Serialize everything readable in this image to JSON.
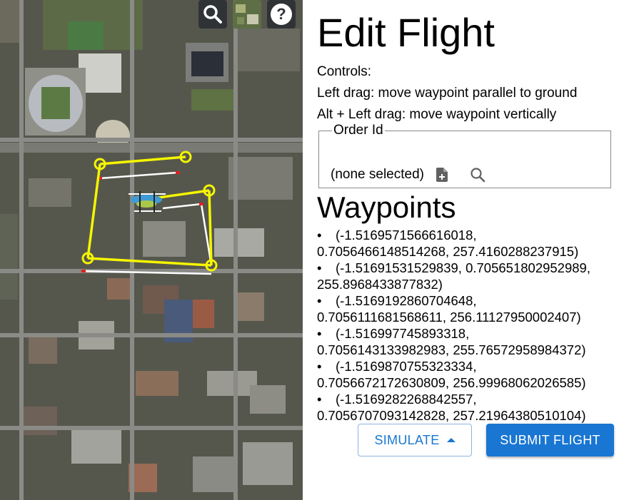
{
  "map": {
    "buttons": [
      {
        "name": "search-icon"
      },
      {
        "name": "base-layer-picker"
      },
      {
        "name": "help-icon",
        "label": "?"
      }
    ]
  },
  "panel": {
    "title": "Edit Flight",
    "controls": [
      "Controls:",
      "Left drag: move waypoint parallel to ground",
      "Alt + Left drag: move waypoint vertically"
    ],
    "order": {
      "legend": "Order Id",
      "value": "(none selected)",
      "icons": [
        "add-file-icon",
        "search-icon"
      ]
    },
    "waypoints_title": "Waypoints",
    "waypoints": [
      "(-1.5169571566616018, 0.7056466148514268, 257.4160288237915)",
      "(-1.51691531529839, 0.705651802952989, 255.8968433877832)",
      "(-1.5169192860704648, 0.7056111681568611, 256.1112795000240?)",
      "(-1.516997745893318, 0.7056143133982983, 255.76572958984372)",
      "(-1.5169870755323334, 0.7056672172630809, 256.99968062026585)",
      "(-1.5169282268842557, 0.705670709314282?, 257.21964380510104)"
    ],
    "waypoint_lines": [
      [
        "(-1.5169571566616018,",
        "0.7056466148514268, 257.4160288237915)"
      ],
      [
        "(-1.51691531529839, 0.705651802952989,",
        "255.8968433877832)"
      ],
      [
        "(-1.5169192860704648,",
        "0.7056111681568611, 256.11127950002407)"
      ],
      [
        "(-1.516997745893318,",
        "0.7056143133982983, 255.76572958984372)"
      ],
      [
        "(-1.5169870755323334,",
        "0.7056672172630809, 256.99968062026585)"
      ],
      [
        "(-1.5169282268842557,",
        "0.7056707093142828, 257.21964380510104)"
      ]
    ],
    "simulate_label": "SIMULATE",
    "submit_label": "SUBMIT FLIGHT",
    "colors": {
      "primary": "#1976d2",
      "waypoint": "#f5f500"
    }
  }
}
